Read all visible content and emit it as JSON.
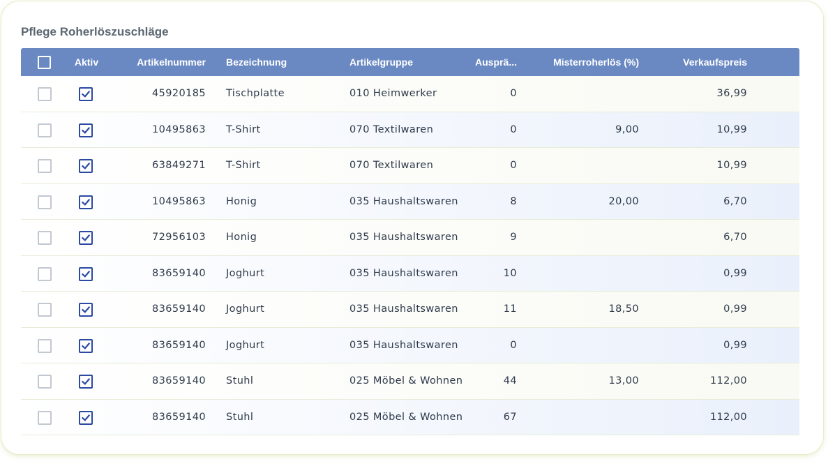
{
  "page": {
    "title": "Pflege Roherlöszuschläge"
  },
  "table": {
    "columns": {
      "aktiv": "Aktiv",
      "artikelnummer": "Artikelnummer",
      "bezeichnung": "Bezeichnung",
      "artikelgruppe": "Artikelgruppe",
      "auspraegung": "Ausprä...",
      "misterroherloes": "Misterroherlös (%)",
      "verkaufspreis": "Verkaufspreis"
    },
    "rows": [
      {
        "aktiv": true,
        "artikelnummer": "45920185",
        "bezeichnung": "Tischplatte",
        "artikelgruppe": "010 Heimwerker",
        "auspraegung": "0",
        "misterroherloes": "",
        "verkaufspreis": "36,99"
      },
      {
        "aktiv": true,
        "artikelnummer": "10495863",
        "bezeichnung": "T-Shirt",
        "artikelgruppe": "070 Textilwaren",
        "auspraegung": "0",
        "misterroherloes": "9,00",
        "verkaufspreis": "10,99"
      },
      {
        "aktiv": true,
        "artikelnummer": "63849271",
        "bezeichnung": "T-Shirt",
        "artikelgruppe": "070 Textilwaren",
        "auspraegung": "0",
        "misterroherloes": "",
        "verkaufspreis": "10,99"
      },
      {
        "aktiv": true,
        "artikelnummer": "10495863",
        "bezeichnung": "Honig",
        "artikelgruppe": "035 Haushaltswaren",
        "auspraegung": "8",
        "misterroherloes": "20,00",
        "verkaufspreis": "6,70"
      },
      {
        "aktiv": true,
        "artikelnummer": "72956103",
        "bezeichnung": "Honig",
        "artikelgruppe": "035 Haushaltswaren",
        "auspraegung": "9",
        "misterroherloes": "",
        "verkaufspreis": "6,70"
      },
      {
        "aktiv": true,
        "artikelnummer": "83659140",
        "bezeichnung": "Joghurt",
        "artikelgruppe": "035 Haushaltswaren",
        "auspraegung": "10",
        "misterroherloes": "",
        "verkaufspreis": "0,99"
      },
      {
        "aktiv": true,
        "artikelnummer": "83659140",
        "bezeichnung": "Joghurt",
        "artikelgruppe": "035 Haushaltswaren",
        "auspraegung": "11",
        "misterroherloes": "18,50",
        "verkaufspreis": "0,99"
      },
      {
        "aktiv": true,
        "artikelnummer": "83659140",
        "bezeichnung": "Joghurt",
        "artikelgruppe": "035 Haushaltswaren",
        "auspraegung": "0",
        "misterroherloes": "",
        "verkaufspreis": "0,99"
      },
      {
        "aktiv": true,
        "artikelnummer": "83659140",
        "bezeichnung": "Stuhl",
        "artikelgruppe": "025 Möbel & Wohnen",
        "auspraegung": "44",
        "misterroherloes": "13,00",
        "verkaufspreis": "112,00"
      },
      {
        "aktiv": true,
        "artikelnummer": "83659140",
        "bezeichnung": "Stuhl",
        "artikelgruppe": "025 Möbel & Wohnen",
        "auspraegung": "67",
        "misterroherloes": "",
        "verkaufspreis": "112,00"
      }
    ]
  },
  "colors": {
    "header": "#6a89c3",
    "checkbox_checked": "#2a4aa0"
  },
  "icons": {
    "checked": "checkmark-icon"
  }
}
